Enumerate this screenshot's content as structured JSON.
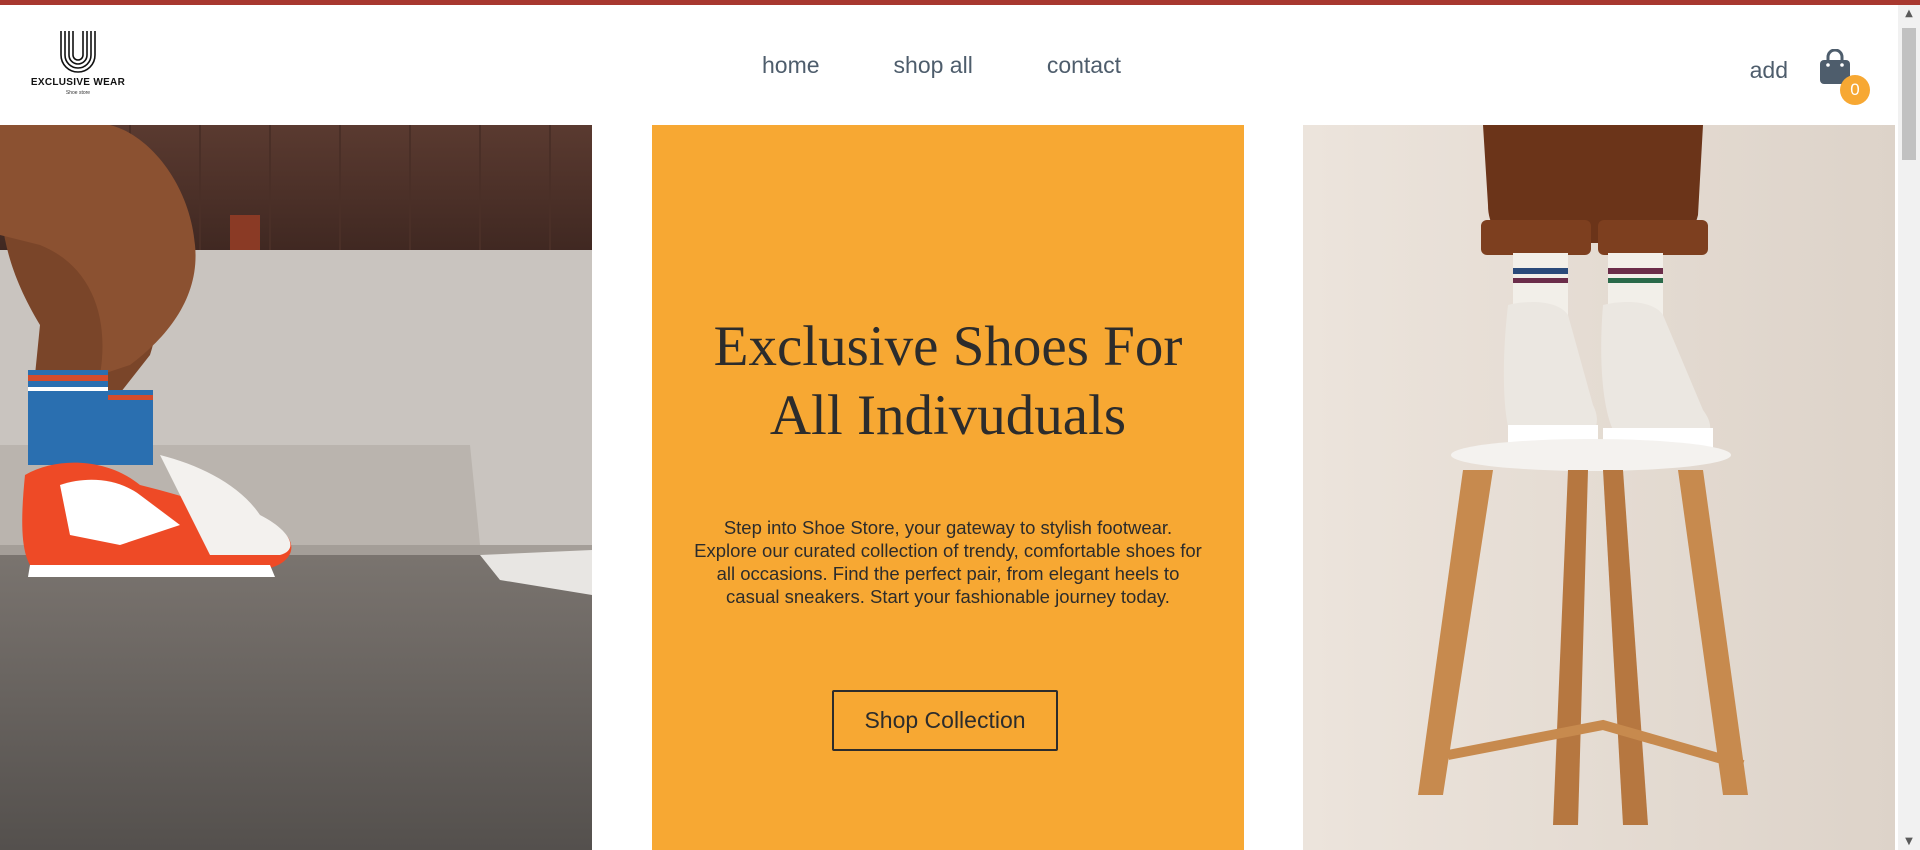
{
  "brand": {
    "name": "EXCLUSIVE WEAR",
    "tagline": "Shoe store",
    "logo_icon": "u-monogram-icon"
  },
  "nav": {
    "items": [
      {
        "label": "home"
      },
      {
        "label": "shop all"
      },
      {
        "label": "contact"
      }
    ]
  },
  "header": {
    "add_label": "add",
    "cart_icon": "shopping-bag-icon",
    "cart_count": "0"
  },
  "hero": {
    "title_line1": "Exclusive Shoes For",
    "title_line2": "All Indivuduals",
    "description": "Step into Shoe Store, your gateway to stylish footwear. Explore our curated collection of trendy, comfortable shoes for all occasions. Find the perfect pair, from elegant heels to casual sneakers. Start your fashionable journey today.",
    "button_label": "Shop Collection"
  },
  "colors": {
    "accent": "#f7a833",
    "top_bar": "#a8382f",
    "nav_text": "#4e5d6c",
    "dark_text": "#2c2c2c"
  }
}
